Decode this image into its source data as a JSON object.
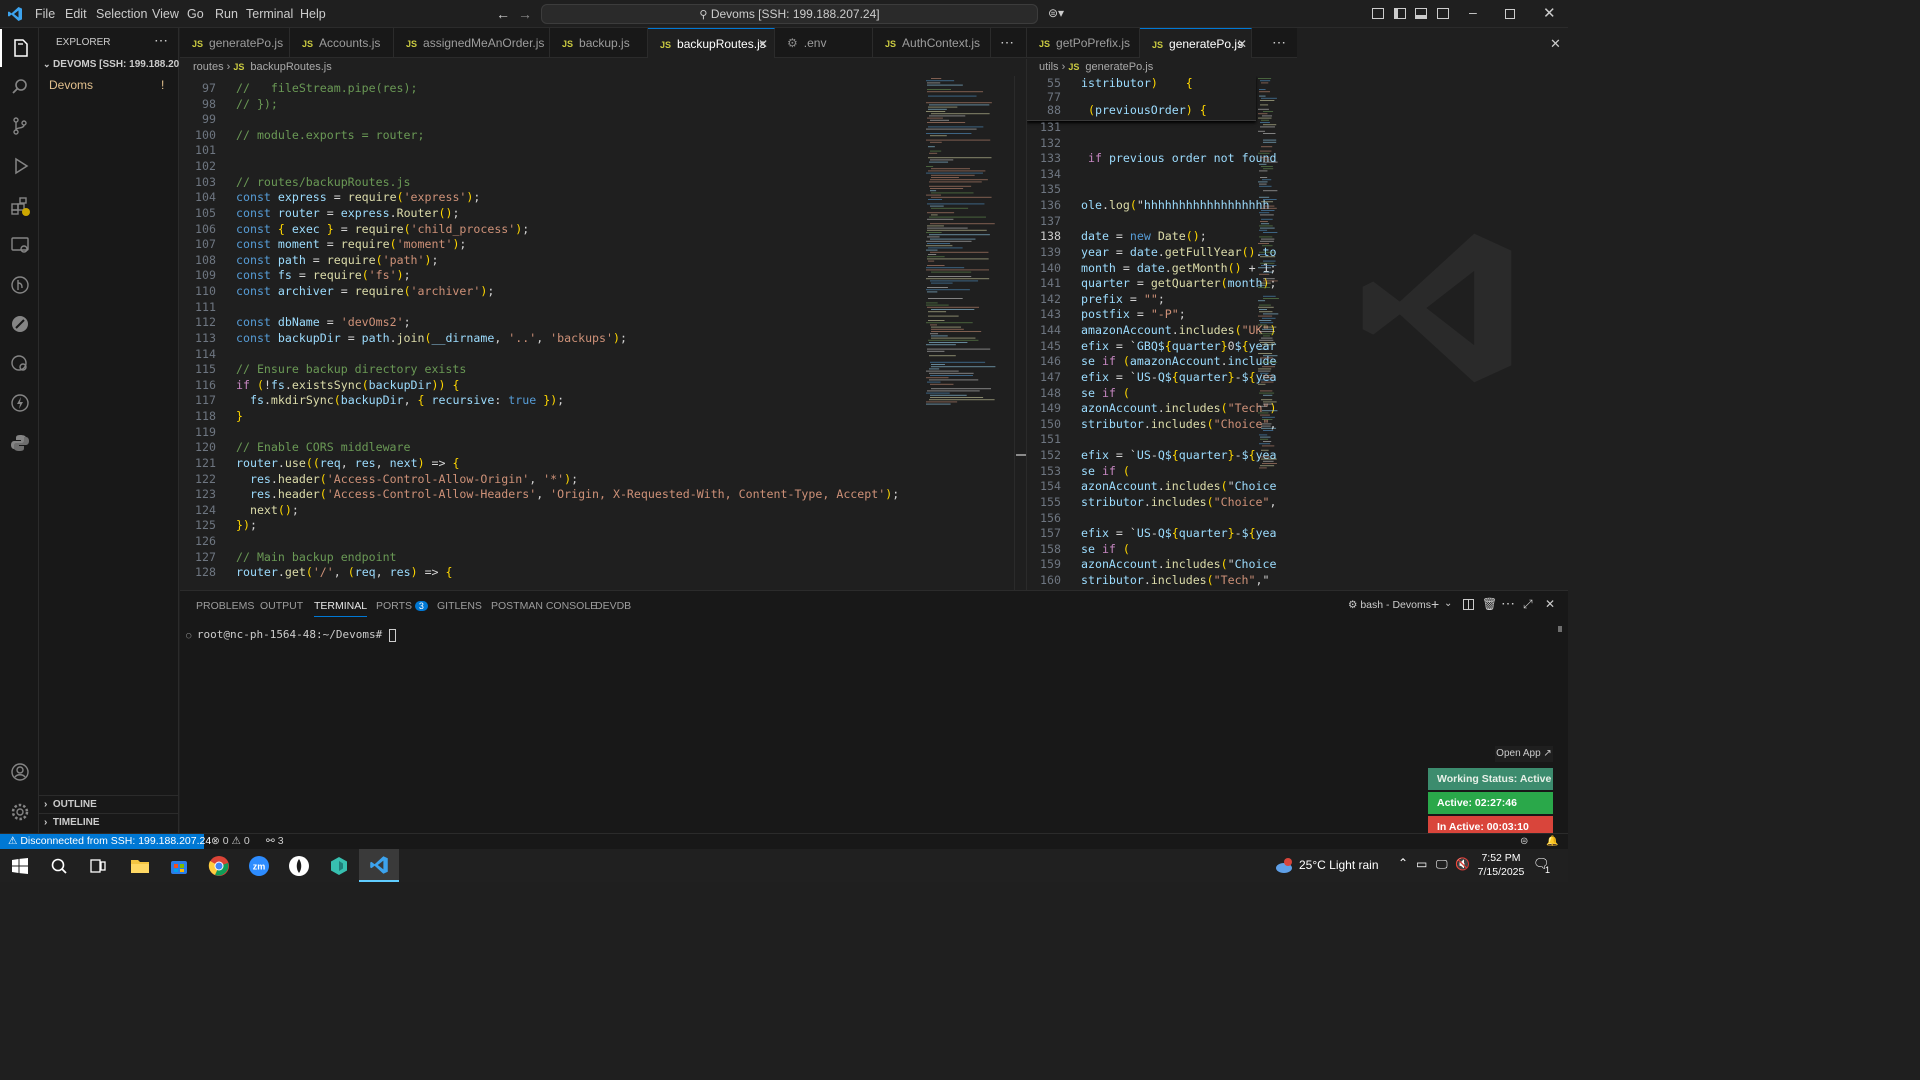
{
  "titlebar": {
    "menu": [
      "File",
      "Edit",
      "Selection",
      "View",
      "Go",
      "Run",
      "Terminal",
      "Help"
    ],
    "command_center": "Devoms [SSH: 199.188.207.24]"
  },
  "explorer": {
    "title": "EXPLORER",
    "root": "DEVOMS [SSH: 199.188.20...",
    "item": "Devoms",
    "item_badge": "!",
    "outline": "OUTLINE",
    "timeline": "TIMELINE"
  },
  "left_tabs": [
    "generatePo.js",
    "Accounts.js",
    "assignedMeAnOrder.js",
    "backup.js",
    "backupRoutes.js",
    ".env",
    "AuthContext.js"
  ],
  "right_tabs": [
    "getPoPrefix.js",
    "generatePo.js"
  ],
  "left_breadcrumb": [
    "routes",
    "backupRoutes.js"
  ],
  "right_breadcrumb": [
    "utils",
    "generatePo.js"
  ],
  "left_code": [
    {
      "n": "97",
      "t": "//   fileStream.pipe(res);"
    },
    {
      "n": "98",
      "t": "// });"
    },
    {
      "n": "99",
      "t": ""
    },
    {
      "n": "100",
      "t": "// module.exports = router;"
    },
    {
      "n": "101",
      "t": ""
    },
    {
      "n": "102",
      "t": ""
    },
    {
      "n": "103",
      "t": "// routes/backupRoutes.js"
    },
    {
      "n": "104",
      "t": "const express = require('express');"
    },
    {
      "n": "105",
      "t": "const router = express.Router();"
    },
    {
      "n": "106",
      "t": "const { exec } = require('child_process');"
    },
    {
      "n": "107",
      "t": "const moment = require('moment');"
    },
    {
      "n": "108",
      "t": "const path = require('path');"
    },
    {
      "n": "109",
      "t": "const fs = require('fs');"
    },
    {
      "n": "110",
      "t": "const archiver = require('archiver');"
    },
    {
      "n": "111",
      "t": ""
    },
    {
      "n": "112",
      "t": "const dbName = 'devOms2';"
    },
    {
      "n": "113",
      "t": "const backupDir = path.join(__dirname, '..', 'backups');"
    },
    {
      "n": "114",
      "t": ""
    },
    {
      "n": "115",
      "t": "// Ensure backup directory exists"
    },
    {
      "n": "116",
      "t": "if (!fs.existsSync(backupDir)) {"
    },
    {
      "n": "117",
      "t": "  fs.mkdirSync(backupDir, { recursive: true });"
    },
    {
      "n": "118",
      "t": "}"
    },
    {
      "n": "119",
      "t": ""
    },
    {
      "n": "120",
      "t": "// Enable CORS middleware"
    },
    {
      "n": "121",
      "t": "router.use((req, res, next) => {"
    },
    {
      "n": "122",
      "t": "  res.header('Access-Control-Allow-Origin', '*');"
    },
    {
      "n": "123",
      "t": "  res.header('Access-Control-Allow-Headers', 'Origin, X-Requested-With, Content-Type, Accept');"
    },
    {
      "n": "124",
      "t": "  next();"
    },
    {
      "n": "125",
      "t": "});"
    },
    {
      "n": "126",
      "t": ""
    },
    {
      "n": "127",
      "t": "// Main backup endpoint"
    },
    {
      "n": "128",
      "t": "router.get('/', (req, res) => {"
    }
  ],
  "right_sticky": [
    {
      "n": "55",
      "t": "istributor)    {"
    },
    {
      "n": "77",
      "t": ""
    },
    {
      "n": "88",
      "t": " (previousOrder) {"
    }
  ],
  "right_code": [
    {
      "n": "131",
      "t": ""
    },
    {
      "n": "132",
      "t": ""
    },
    {
      "n": "133",
      "t": " if previous order not found"
    },
    {
      "n": "134",
      "t": ""
    },
    {
      "n": "135",
      "t": ""
    },
    {
      "n": "136",
      "t": "ole.log(\"hhhhhhhhhhhhhhhhhh"
    },
    {
      "n": "137",
      "t": ""
    },
    {
      "n": "138",
      "t": "date = new Date();"
    },
    {
      "n": "139",
      "t": "year = date.getFullYear().to"
    },
    {
      "n": "140",
      "t": "month = date.getMonth() + 1;"
    },
    {
      "n": "141",
      "t": "quarter = getQuarter(month);"
    },
    {
      "n": "142",
      "t": "prefix = \"\";"
    },
    {
      "n": "143",
      "t": "postfix = \"-P\";"
    },
    {
      "n": "144",
      "t": "amazonAccount.includes(\"UK\")"
    },
    {
      "n": "145",
      "t": "efix = `GBQ${quarter}0${year"
    },
    {
      "n": "146",
      "t": "se if (amazonAccount.include"
    },
    {
      "n": "147",
      "t": "efix = `US-Q${quarter}-${yea"
    },
    {
      "n": "148",
      "t": "se if ("
    },
    {
      "n": "149",
      "t": "azonAccount.includes(\"Tech\")"
    },
    {
      "n": "150",
      "t": "stributor.includes(\"Choice\","
    },
    {
      "n": "151",
      "t": ""
    },
    {
      "n": "152",
      "t": "efix = `US-Q${quarter}-${yea"
    },
    {
      "n": "153",
      "t": "se if ("
    },
    {
      "n": "154",
      "t": "azonAccount.includes(\"Choice"
    },
    {
      "n": "155",
      "t": "stributor.includes(\"Choice\","
    },
    {
      "n": "156",
      "t": ""
    },
    {
      "n": "157",
      "t": "efix = `US-Q${quarter}-${yea"
    },
    {
      "n": "158",
      "t": "se if ("
    },
    {
      "n": "159",
      "t": "azonAccount.includes(\"Choice"
    },
    {
      "n": "160",
      "t": "stributor.includes(\"Tech\",\""
    }
  ],
  "panel": {
    "tabs": [
      "PROBLEMS",
      "OUTPUT",
      "TERMINAL",
      "PORTS",
      "GITLENS",
      "POSTMAN CONSOLE",
      "DEVDB"
    ],
    "ports_badge": "3",
    "shell": "bash - Devoms",
    "prompt": "root@nc-ph-1564-48:~/Devoms#"
  },
  "overlay": {
    "open_app": "Open App ↗",
    "working_status": "Working Status: Active",
    "active": "Active: 02:27:46",
    "inactive": "In Active: 00:03:10"
  },
  "statusbar": {
    "remote": "Disconnected from SSH: 199.188.207.24",
    "errors": "0",
    "warnings": "0",
    "ports": "3"
  },
  "taskbar": {
    "weather": "25°C  Light rain",
    "time": "7:52 PM",
    "date": "7/15/2025",
    "notif": "1"
  },
  "colors": {
    "accent": "#0078d4",
    "remote_bg": "#0078d4",
    "working": "#3c8c6e",
    "active": "#2aa84a",
    "inactive": "#d9453b"
  }
}
